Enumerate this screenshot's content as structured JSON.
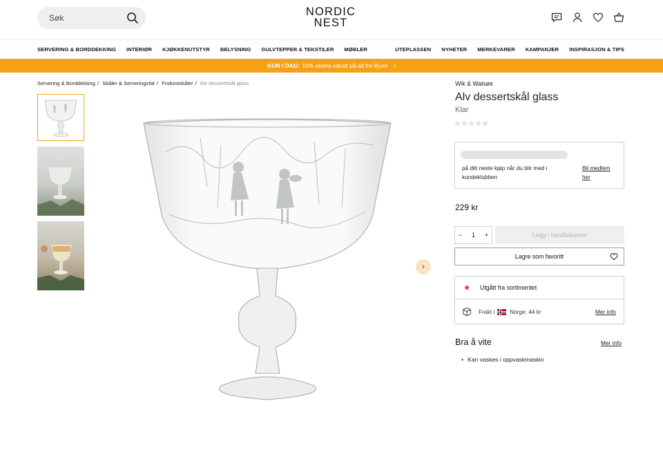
{
  "header": {
    "search_placeholder": "Søk",
    "logo_line1": "NORDIC",
    "logo_line2": "NEST"
  },
  "nav": {
    "left": [
      "SERVERING & BORDDEKKING",
      "INTERIØR",
      "KJØKKENUTSTYR",
      "BELYSNING",
      "GULVTEPPER & TEKSTILER",
      "MØBLER"
    ],
    "right": [
      "UTEPLASSEN",
      "NYHETER",
      "MERKEVARER",
      "KAMPANJER",
      "INSPIRASJON & TIPS"
    ]
  },
  "promo": {
    "bold": "KUN I DAG:",
    "text": "10% ekstra rabatt på alt fra Byon",
    "arrow": "›"
  },
  "breadcrumb": [
    "Servering & Borddekking",
    "Skåler & Serveringsfat",
    "Frokostskåler",
    "Alv dessertskål glass"
  ],
  "product": {
    "brand": "Wik & Walsøe",
    "title": "Alv dessertskål glass",
    "variant": "Klar",
    "member_text": "på ditt neste kjøp når du blir med i kundeklubben",
    "member_link": "Bli medlem her",
    "price": "229 kr",
    "quantity": "1",
    "qty_minus": "−",
    "qty_plus": "+",
    "add_to_cart": "Legg i handlekurven",
    "favorite": "Lagre som favoritt",
    "status": "Utgått fra sortimentet",
    "shipping_label": "Frakt i",
    "shipping_country": "Norge: 44 kr",
    "shipping_more": "Mer info",
    "good_to_know_title": "Bra å vite",
    "good_to_know_more": "Mer info",
    "good_to_know_items": [
      "Kan vaskes i oppvaskmaskin"
    ]
  },
  "colors": {
    "accent": "#f5a118",
    "status_red": "#e34b4b"
  }
}
